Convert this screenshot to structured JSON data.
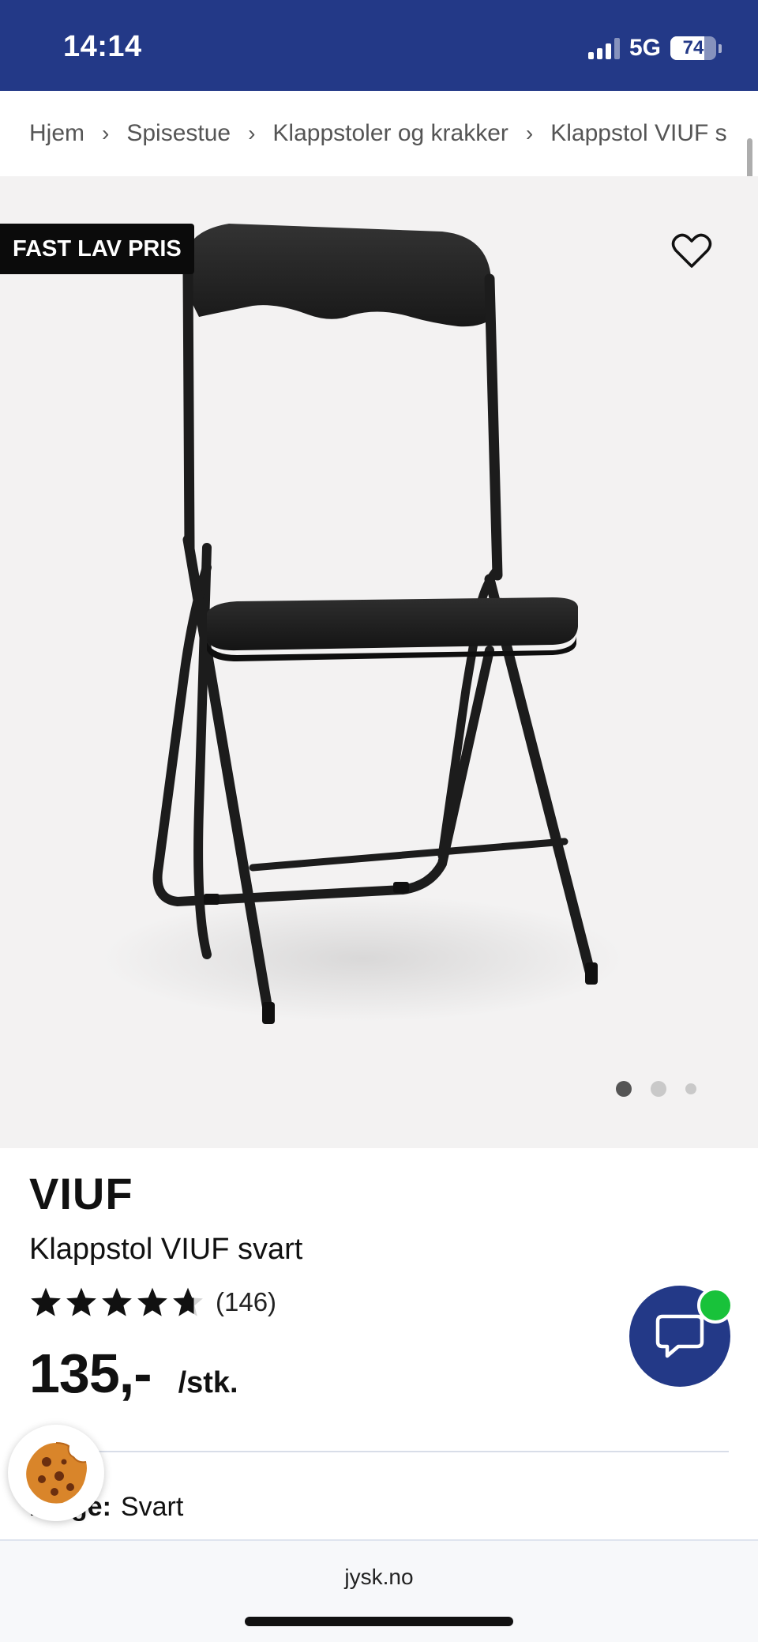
{
  "status_bar": {
    "time": "14:14",
    "network": "5G",
    "battery": "74",
    "battery_level": 0.74,
    "background_color": "#233987"
  },
  "breadcrumb": {
    "items": [
      "Hjem",
      "Spisestue",
      "Klappstoler og krakker"
    ],
    "current": "Klappstol VIUF s",
    "separator": "›"
  },
  "gallery": {
    "badge": "FAST LAV PRIS",
    "wishlist_icon": "heart-outline-icon",
    "image_count": 3,
    "active_index": 0
  },
  "product": {
    "brand": "VIUF",
    "name": "Klappstol VIUF svart",
    "rating": 4.7,
    "rating_max": 5,
    "review_count": "(146)",
    "price": "135,-",
    "unit": "/stk.",
    "color_label": "Farge:",
    "color_value": "Svart"
  },
  "chat": {
    "icon": "chat-bubble-icon",
    "status_color": "#18c23a"
  },
  "cookie": {
    "icon": "cookie-icon"
  },
  "browser": {
    "url": "jysk.no"
  }
}
